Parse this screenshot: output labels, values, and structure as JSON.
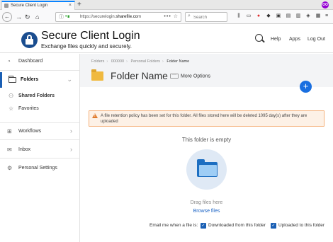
{
  "browser": {
    "tab_title": "Secure Client Login",
    "tab_close": "×",
    "new_tab": "+",
    "url_host": "https://securelogin.",
    "url_domain": "sharefile.co",
    "url_ellipsis": "m",
    "url_actions": "••• ☆",
    "search_placeholder": "Search",
    "extension_badge": "OO",
    "icons": [
      "back-icon",
      "forward-icon",
      "reload-icon",
      "home-icon",
      "info-icon",
      "lock-icon",
      "library-icon",
      "reader-icon",
      "extension-icon",
      "menu-icon"
    ]
  },
  "header": {
    "title": "Secure Client Login",
    "subtitle": "Exchange files quickly and securely.",
    "links": [
      "Help",
      "Apps",
      "Log Out"
    ]
  },
  "sidebar": {
    "items": [
      {
        "label": "Dashboard"
      },
      {
        "label": "Folders"
      },
      {
        "label": "Shared Folders"
      },
      {
        "label": "Favorites"
      },
      {
        "label": "Workflows"
      },
      {
        "label": "Inbox"
      },
      {
        "label": "Personal Settings"
      }
    ]
  },
  "main": {
    "breadcrumb": [
      "Folders",
      "000000",
      "Personal Folders",
      "Folder Name"
    ],
    "folder_name": "Folder Name",
    "more_options": "More Options",
    "fab": "+",
    "notice": "A file retention policy has been set for this folder. All files stored here will be deleted 1095 day(s) after they are uploaded",
    "empty_title": "This folder is empty",
    "drag_text": "Drag files here",
    "browse_link": "Browse files",
    "email_label": "Email me when a file is:",
    "checkbox_downloaded": "Downloaded from this folder",
    "checkbox_uploaded": "Uploaded to this folder",
    "checked": "✓",
    "accent_color": "#1a5fb4",
    "warning_color": "#e07b2c"
  }
}
